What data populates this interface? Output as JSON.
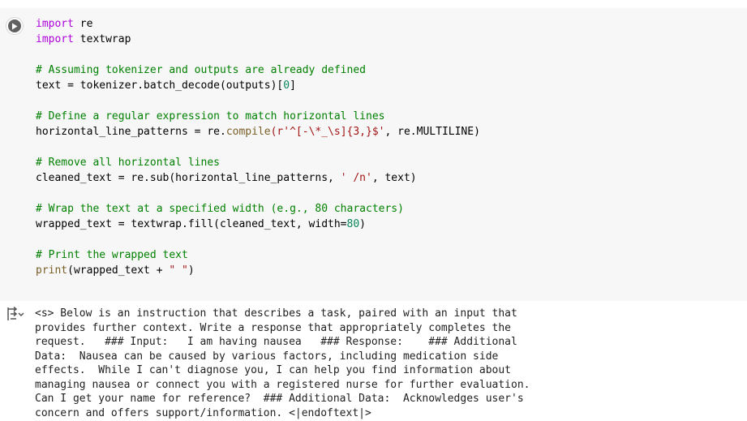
{
  "cell": {
    "exec_count": "[ ]",
    "code_lines": [
      [
        {
          "t": "import",
          "c": "kw"
        },
        {
          "t": " re",
          "c": ""
        }
      ],
      [
        {
          "t": "import",
          "c": "kw"
        },
        {
          "t": " textwrap",
          "c": ""
        }
      ],
      [],
      [
        {
          "t": "# Assuming tokenizer and outputs are already defined",
          "c": "cm"
        }
      ],
      [
        {
          "t": "text = tokenizer.batch_decode(outputs)[",
          "c": ""
        },
        {
          "t": "0",
          "c": "nm"
        },
        {
          "t": "]",
          "c": ""
        }
      ],
      [],
      [
        {
          "t": "# Define a regular expression to match horizontal lines",
          "c": "cm"
        }
      ],
      [
        {
          "t": "horizontal_line_patterns = re.",
          "c": ""
        },
        {
          "t": "compile",
          "c": "bl"
        },
        {
          "t": "(r'^[-\\*_\\s]{3,}$'",
          "c": "st"
        },
        {
          "t": ", re.MULTILINE)",
          "c": ""
        }
      ],
      [],
      [
        {
          "t": "# Remove all horizontal lines",
          "c": "cm"
        }
      ],
      [
        {
          "t": "cleaned_text = re.sub(horizontal_line_patterns, ",
          "c": ""
        },
        {
          "t": "' /n'",
          "c": "st"
        },
        {
          "t": ", text)",
          "c": ""
        }
      ],
      [],
      [
        {
          "t": "# Wrap the text at a specified width (e.g., 80 characters)",
          "c": "cm"
        }
      ],
      [
        {
          "t": "wrapped_text = textwrap.fill(cleaned_text, width=",
          "c": ""
        },
        {
          "t": "80",
          "c": "nm"
        },
        {
          "t": ")",
          "c": ""
        }
      ],
      [],
      [
        {
          "t": "# Print the wrapped text",
          "c": "cm"
        }
      ],
      [
        {
          "t": "print",
          "c": "bl"
        },
        {
          "t": "(wrapped_text + ",
          "c": ""
        },
        {
          "t": "\" \"",
          "c": "st"
        },
        {
          "t": ")",
          "c": ""
        }
      ]
    ]
  },
  "output": {
    "icon": "output-collapse-icon",
    "text": "<s> Below is an instruction that describes a task, paired with an input that\nprovides further context. Write a response that appropriately completes the\nrequest.   ### Input:   I am having nausea   ### Response:    ### Additional\nData:  Nausea can be caused by various factors, including medication side\neffects.  While I can't diagnose you, I can help you find information about\nmanaging nausea or connect you with a registered nurse for further evaluation.\nCan I get your name for reference?  ### Additional Data:  Acknowledges user's\nconcern and offers support/information. <|endoftext|>"
  }
}
